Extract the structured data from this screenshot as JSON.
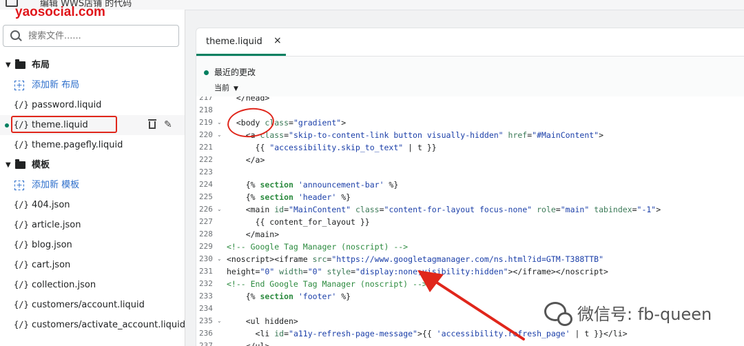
{
  "topbar": {
    "title": "编辑 WWS店铺 的代码",
    "more": "···"
  },
  "watermark_brand": "yaosocial.com",
  "sidebar": {
    "search_placeholder": "搜索文件......",
    "tree": [
      {
        "type": "folder",
        "label": "布局"
      },
      {
        "type": "add",
        "label": "添加新 布局"
      },
      {
        "type": "file",
        "label": "password.liquid"
      },
      {
        "type": "file",
        "label": "theme.liquid",
        "active": true
      },
      {
        "type": "file",
        "label": "theme.pagefly.liquid"
      },
      {
        "type": "folder",
        "label": "模板"
      },
      {
        "type": "add",
        "label": "添加新 模板"
      },
      {
        "type": "file",
        "label": "404.json"
      },
      {
        "type": "file",
        "label": "article.json"
      },
      {
        "type": "file",
        "label": "blog.json"
      },
      {
        "type": "file",
        "label": "cart.json"
      },
      {
        "type": "file",
        "label": "collection.json"
      },
      {
        "type": "file",
        "label": "customers/account.liquid"
      },
      {
        "type": "file",
        "label": "customers/activate_account.liquid"
      }
    ],
    "file_icon": "{/}"
  },
  "editor": {
    "tab_label": "theme.liquid",
    "tab_close": "×",
    "recent_changes": "最近的更改",
    "current": "当前",
    "caret": "▼",
    "line_numbers": [
      "217",
      "218",
      "219",
      "220",
      "221",
      "222",
      "223",
      "224",
      "225",
      "226",
      "227",
      "228",
      "229",
      "230",
      "231",
      "232",
      "233",
      "234",
      "235",
      "236",
      "237"
    ],
    "foldable": [
      "219",
      "220",
      "226",
      "230",
      "235"
    ],
    "lines": [
      "  </head>",
      "",
      "  <body class=\"gradient\">",
      "    <a class=\"skip-to-content-link button visually-hidden\" href=\"#MainContent\">",
      "      {{ \"accessibility.skip_to_text\" | t }}",
      "    </a>",
      "",
      "    {% section 'announcement-bar' %}",
      "    {% section 'header' %}",
      "    <main id=\"MainContent\" class=\"content-for-layout focus-none\" role=\"main\" tabindex=\"-1\">",
      "      {{ content_for_layout }}",
      "    </main>",
      "<!-- Google Tag Manager (noscript) -->",
      "<noscript><iframe src=\"https://www.googletagmanager.com/ns.html?id=GTM-T388TTB\"",
      "height=\"0\" width=\"0\" style=\"display:none;visibility:hidden\"></iframe></noscript>",
      "<!-- End Google Tag Manager (noscript) -->",
      "    {% section 'footer' %}",
      "",
      "    <ul hidden>",
      "      <li id=\"a11y-refresh-page-message\">{{ 'accessibility.refresh_page' | t }}</li>",
      "    </ul>"
    ]
  },
  "watermark": {
    "icon": "wechat-icon",
    "text": "微信号: fb-queen"
  },
  "colors": {
    "accent": "#008060",
    "annotation": "#e0261b",
    "link": "#2c6ecb"
  }
}
